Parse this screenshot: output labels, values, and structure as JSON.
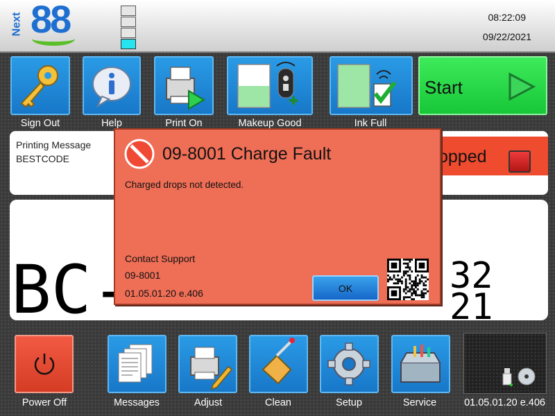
{
  "header": {
    "logo_text": "88",
    "logo_prefix": "Next",
    "time": "08:22:09",
    "date": "09/22/2021",
    "ink_level": {
      "segments": 4,
      "filled": 1
    }
  },
  "toolbar": {
    "sign_out": "Sign Out",
    "help": "Help",
    "print_on": "Print On",
    "makeup": "Makeup Good",
    "ink": "Ink Full",
    "start": "Start"
  },
  "message_panel": {
    "line1": "Printing Message",
    "line2": "BESTCODE"
  },
  "status": {
    "text": "opped",
    "color": "#ee4b2f"
  },
  "preview": {
    "line_big": "BC-",
    "line_small_top": "32",
    "line_small_bottom": "21"
  },
  "dialog": {
    "title": "09-8001 Charge Fault",
    "description": "Charged drops not detected.",
    "contact": "Contact Support",
    "code": "09-8001",
    "version": "01.05.01.20 e.406",
    "ok_label": "OK",
    "background": "#ee6e56"
  },
  "bottom": {
    "power_off": "Power Off",
    "messages": "Messages",
    "adjust": "Adjust",
    "clean": "Clean",
    "setup": "Setup",
    "service": "Service",
    "version": "01.05.01.20 e.406"
  },
  "colors": {
    "accent_blue": "#1f7fd6",
    "start_green": "#22d23f",
    "fault_red": "#ee6e56"
  }
}
